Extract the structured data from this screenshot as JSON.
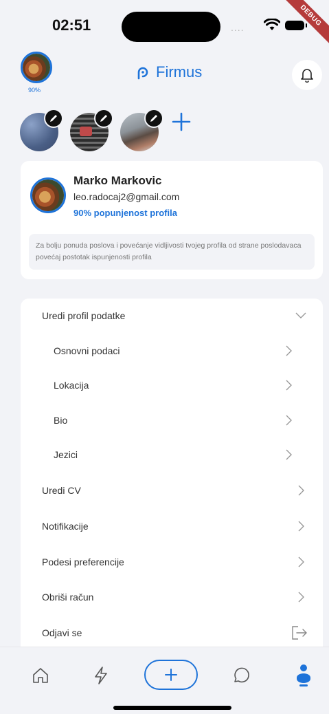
{
  "status_bar": {
    "time": "02:51",
    "debug_label": "DEBUG"
  },
  "header": {
    "profile_percent": "90%",
    "logo_text": "Firmus",
    "accent_color": "#1e73d9"
  },
  "icons": {
    "bell": "bell-icon",
    "edit": "pencil-icon",
    "add_photo": "plus-icon"
  },
  "profile": {
    "name": "Marko Markovic",
    "email": "leo.radocaj2@gmail.com",
    "completeness": "90% popunjenost profila",
    "completeness_value": 0.9,
    "hint": "Za bolju ponuda poslova i povećanje vidljivosti tvojeg profila od strane poslodavaca povećaj postotak ispunjenosti profila"
  },
  "menu": {
    "edit_profile": "Uredi profil podatke",
    "sub_items": [
      "Osnovni podaci",
      "Lokacija",
      "Bio",
      "Jezici"
    ],
    "items": [
      "Uredi CV",
      "Notifikacije",
      "Podesi preferencije",
      "Obriši račun"
    ],
    "logout": "Odjavi se"
  },
  "bottom_nav": [
    "home-icon",
    "lightning-icon",
    "add-icon",
    "chat-icon",
    "profile-icon"
  ]
}
